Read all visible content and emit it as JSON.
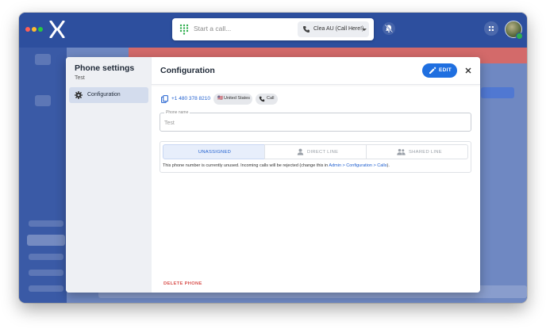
{
  "colors": {
    "accent": "#1f6fe0",
    "window_bg": "#3f5fae",
    "topbar_bg": "#2d4f9e",
    "danger": "#d9534f",
    "traffic_red": "#ff5f57",
    "traffic_yellow": "#febc2e",
    "traffic_green": "#28c840",
    "status_online": "#2fae4e"
  },
  "topbar": {
    "call_placeholder": "Start a call...",
    "caller_id_label": "Clea AU (Call Here!)",
    "icons": [
      "dialpad-icon",
      "phone-icon",
      "chevron-down-icon",
      "bell-off-icon",
      "grid-icon"
    ]
  },
  "modal": {
    "sidebar": {
      "title": "Phone settings",
      "subtitle": "Test",
      "items": [
        {
          "label": "Configuration",
          "icon": "gear-icon",
          "active": true
        }
      ]
    },
    "header": {
      "title": "Configuration",
      "edit_label": "EDIT",
      "close_icon": "close-icon"
    },
    "phone": {
      "number": "+1 480 378 8210",
      "country": "United States",
      "country_flag": "🇺🇸",
      "type": "Call"
    },
    "name_field": {
      "label": "Phone name",
      "placeholder": "Test"
    },
    "assignment": {
      "options": [
        {
          "label": "UNASSIGNED",
          "icon": "",
          "active": true
        },
        {
          "label": "DIRECT LINE",
          "icon": "person-icon",
          "active": false
        },
        {
          "label": "SHARED LINE",
          "icon": "group-icon",
          "active": false
        }
      ],
      "note_text": "This phone number is currently unused. Incoming calls will be rejected (change this in ",
      "note_link": "Admin > Configuration > Calls",
      "note_end": ")."
    },
    "delete_label": "DELETE PHONE"
  }
}
